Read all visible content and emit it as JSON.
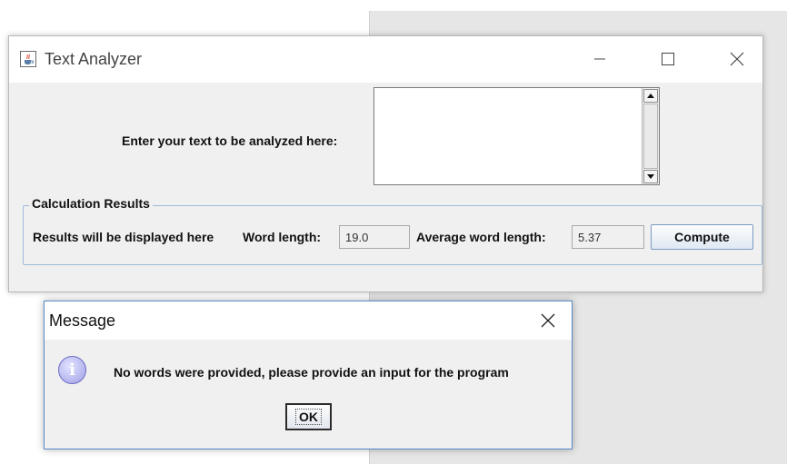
{
  "main_window": {
    "title": "Text Analyzer",
    "icon": "java-cup-icon",
    "controls": [
      "minimize-icon",
      "maximize-icon",
      "close-icon"
    ],
    "input_prompt": "Enter your text to be analyzed here:",
    "input_value": "",
    "results_group": {
      "legend": "Calculation Results",
      "status_label": "Results will be displayed here",
      "word_length_label": "Word length:",
      "word_length_value": "19.0",
      "avg_word_length_label": "Average word length:",
      "avg_word_length_value": "5.37",
      "compute_label": "Compute"
    }
  },
  "message_dialog": {
    "title": "Message",
    "icon": "info-icon",
    "icon_glyph": "i",
    "text": "No words were provided, please provide an input for the program",
    "ok_label": "OK"
  }
}
